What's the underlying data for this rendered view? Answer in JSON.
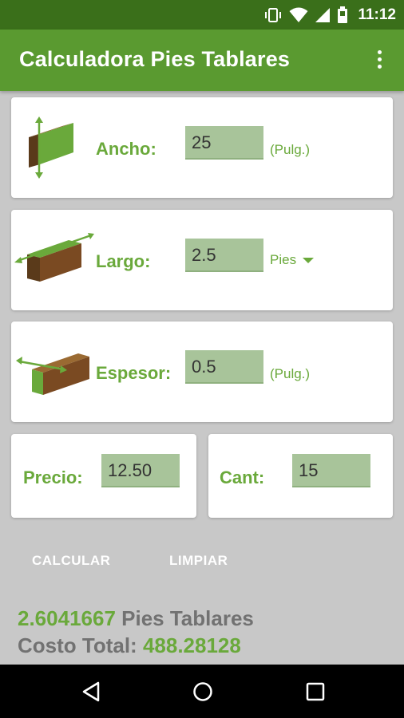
{
  "status": {
    "time": "11:12"
  },
  "appbar": {
    "title": "Calculadora Pies Tablares",
    "menu_icon": "overflow-menu-icon"
  },
  "ancho": {
    "label": "Ancho:",
    "value": "25",
    "unit": "(Pulg.)"
  },
  "largo": {
    "label": "Largo:",
    "value": "2.5",
    "unit": "Pies"
  },
  "espesor": {
    "label": "Espesor:",
    "value": "0.5",
    "unit": "(Pulg.)"
  },
  "precio": {
    "label": "Precio:",
    "value": "12.50"
  },
  "cant": {
    "label": "Cant:",
    "value": "15"
  },
  "buttons": {
    "calcular": "CALCULAR",
    "limpiar": "LIMPIAR"
  },
  "result": {
    "pies_value": "2.6041667",
    "pies_label": "Pies Tablares",
    "costo_label": "Costo Total:",
    "costo_value": "488.28128"
  },
  "colors": {
    "accent": "#6aa93b",
    "appbar": "#5a9a30",
    "statusbar": "#3a6f1a",
    "field": "#a8c49a"
  }
}
